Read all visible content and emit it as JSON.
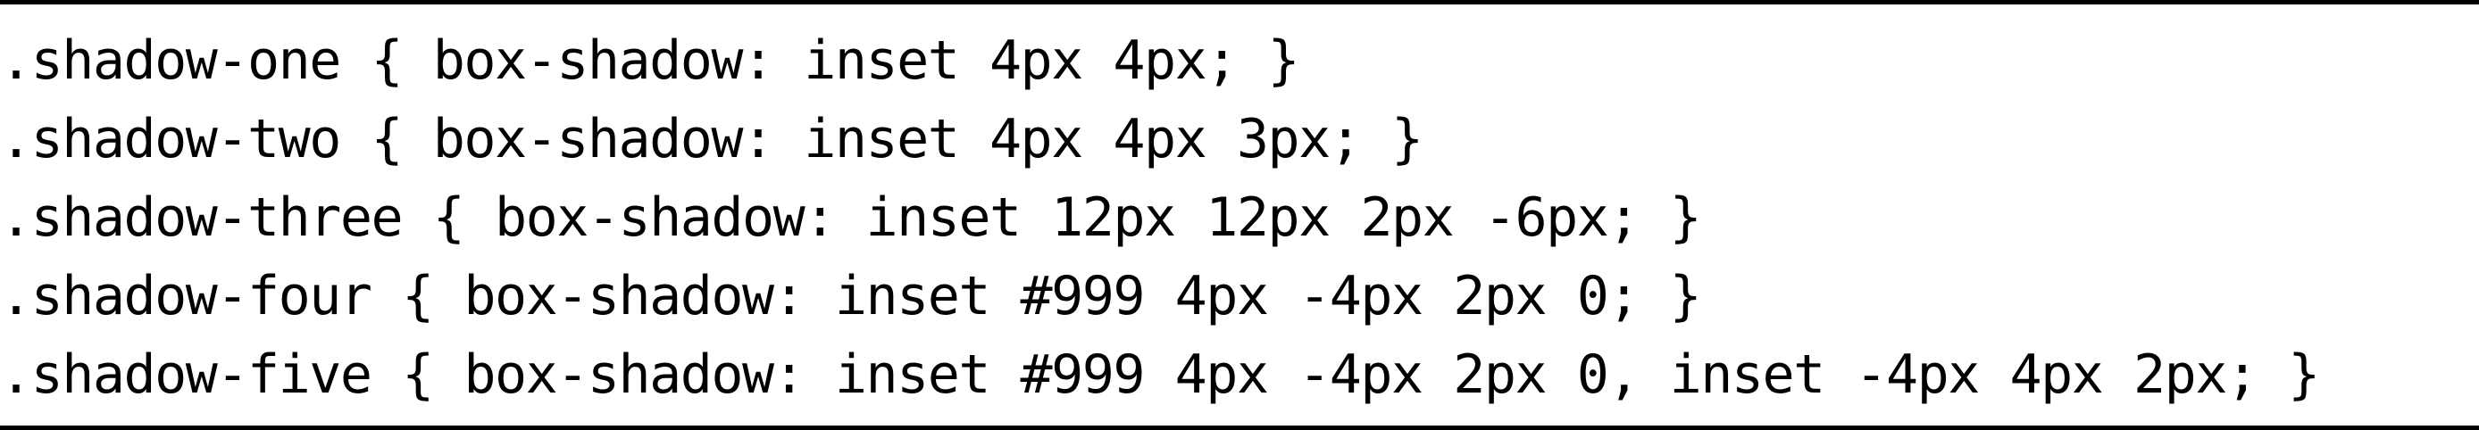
{
  "code": {
    "lines": [
      ".shadow-one { box-shadow: inset 4px 4px; }",
      ".shadow-two { box-shadow: inset 4px 4px 3px; }",
      ".shadow-three { box-shadow: inset 12px 12px 2px -6px; }",
      ".shadow-four { box-shadow: inset #999 4px -4px 2px 0; }",
      ".shadow-five { box-shadow: inset #999 4px -4px 2px 0, inset -4px 4px 2px; }"
    ]
  }
}
